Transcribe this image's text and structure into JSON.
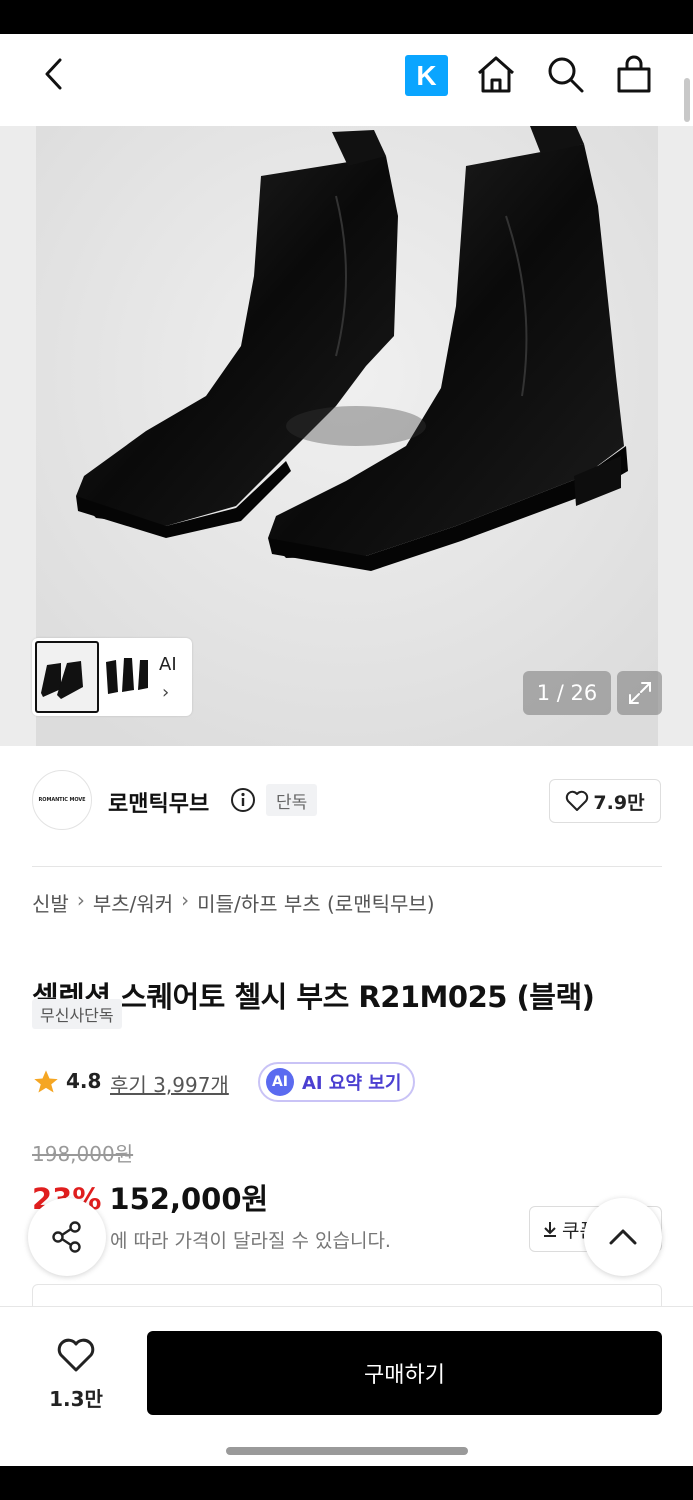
{
  "header": {
    "back_icon": "chevron-left-icon",
    "k_badge": "K",
    "home_icon": "home-icon",
    "search_icon": "search-icon",
    "cart_icon": "shopping-bag-icon"
  },
  "gallery": {
    "thumb_ai_label": "AI",
    "counter": "1 / 26",
    "expand_icon": "expand-icon"
  },
  "brand": {
    "logo_text": "ROMANTIC MOVE",
    "name": "로맨틱무브",
    "badge": "단독",
    "like_count": "7.9만"
  },
  "product": {
    "breadcrumb": [
      "신발",
      "부츠/워커",
      "미들/하프 부츠 (로맨틱무브)"
    ],
    "title": "셀렉션 스퀘어토 첼시 부츠 R21M025 (블랙)",
    "exclusive_tag": "무신사단독",
    "rating": "4.8",
    "reviews": "후기 3,997개",
    "ai_chip": "AI",
    "ai_summary": "AI 요약 보기",
    "original_price": "198,000원",
    "discount": "23%",
    "sale_price": "152,000원",
    "price_note": "에 따라 가격이 달라질 수 있습니다.",
    "coupon_label": "쿠폰"
  },
  "bottom": {
    "wish_count": "1.3만",
    "buy_label": "구매하기"
  },
  "colors": {
    "k_badge": "#0aa5ff",
    "discount": "#e01e1e",
    "ai_purple": "#4b3fd1",
    "star": "#f5a623"
  }
}
